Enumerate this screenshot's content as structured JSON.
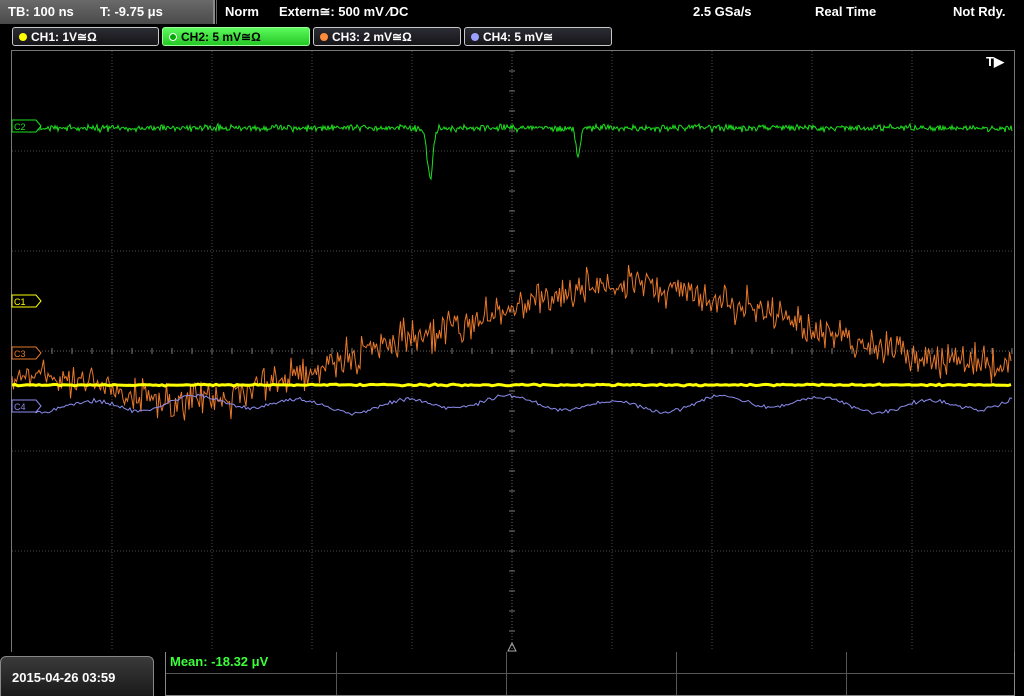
{
  "status_bar": {
    "timebase": "TB: 100 ns",
    "trigger_pos": "T: -9.75 μs",
    "trigger_mode": "Norm",
    "trigger_source": "Extern≅: 500 mV ⁄DC",
    "sample_rate": "2.5 GSa/s",
    "acq_mode": "Real Time",
    "trigger_state": "Not Rdy."
  },
  "channels": [
    {
      "label": "CH1: 1V≅Ω",
      "color": "#ffff00",
      "active": false
    },
    {
      "label": "CH2: 5 mV≅Ω",
      "color": "#22cc22",
      "active": true
    },
    {
      "label": "CH3: 2 mV≅Ω",
      "color": "#ff8c3c",
      "active": false
    },
    {
      "label": "CH4: 5 mV≅",
      "color": "#9aa0ff",
      "active": false
    }
  ],
  "markers": {
    "c1": "C1",
    "c2": "C2",
    "c3": "C3",
    "c4": "C4"
  },
  "trigger_marker": "T▶",
  "bottom": {
    "datetime": "2015-04-26 03:59",
    "measurement": "Mean: -18.32 μV"
  },
  "colors": {
    "ch1": "#ffff00",
    "ch2": "#1ee11e",
    "ch3": "#e8782a",
    "ch4": "#8c8cf0",
    "grid": "#4a4a4a",
    "measure_text": "#3cff3c"
  }
}
